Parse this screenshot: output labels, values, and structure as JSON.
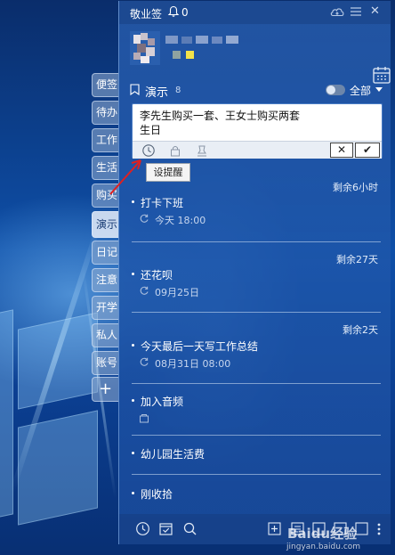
{
  "titlebar": {
    "app_name": "敬业签",
    "reminder_count": "0"
  },
  "category": {
    "name": "演示",
    "count": "8",
    "filter_label": "全部"
  },
  "tabs": [
    "便签",
    "待办",
    "工作",
    "生活",
    "购买",
    "演示",
    "日记",
    "注意",
    "开学",
    "私人",
    "账号"
  ],
  "tab_add_label": "+",
  "editor": {
    "text_line1": "李先生购买一套、王女士购买两套",
    "text_line2": "生日",
    "cancel_label": "✕",
    "ok_label": "✔"
  },
  "tooltip": "设提醒",
  "tasks": [
    {
      "remaining": "剩余6小时",
      "title": "打卡下班",
      "time": "今天 18:00"
    },
    {
      "remaining": "剩余27天",
      "title": "还花呗",
      "time": "09月25日"
    },
    {
      "remaining": "剩余2天",
      "title": "今天最后一天写工作总结",
      "time": "08月31日 08:00"
    },
    {
      "title": "加入音频"
    },
    {
      "title": "幼儿园生活费"
    },
    {
      "title": "刚收拾"
    }
  ],
  "watermark": {
    "brand": "Baidu经验",
    "url": "jingyan.baidu.com"
  },
  "colors": {
    "panel": "#1e56aa",
    "accent_red": "#e02020",
    "editor_border": "#4a7cc4"
  },
  "icons": [
    "bell-icon",
    "cloud-icon",
    "menu-icon",
    "calendar-icon",
    "bookmark-icon",
    "clock-icon",
    "lock-icon",
    "pin-icon",
    "repeat-icon",
    "search-icon",
    "checkbox-icon",
    "add-icon",
    "more-icon"
  ]
}
